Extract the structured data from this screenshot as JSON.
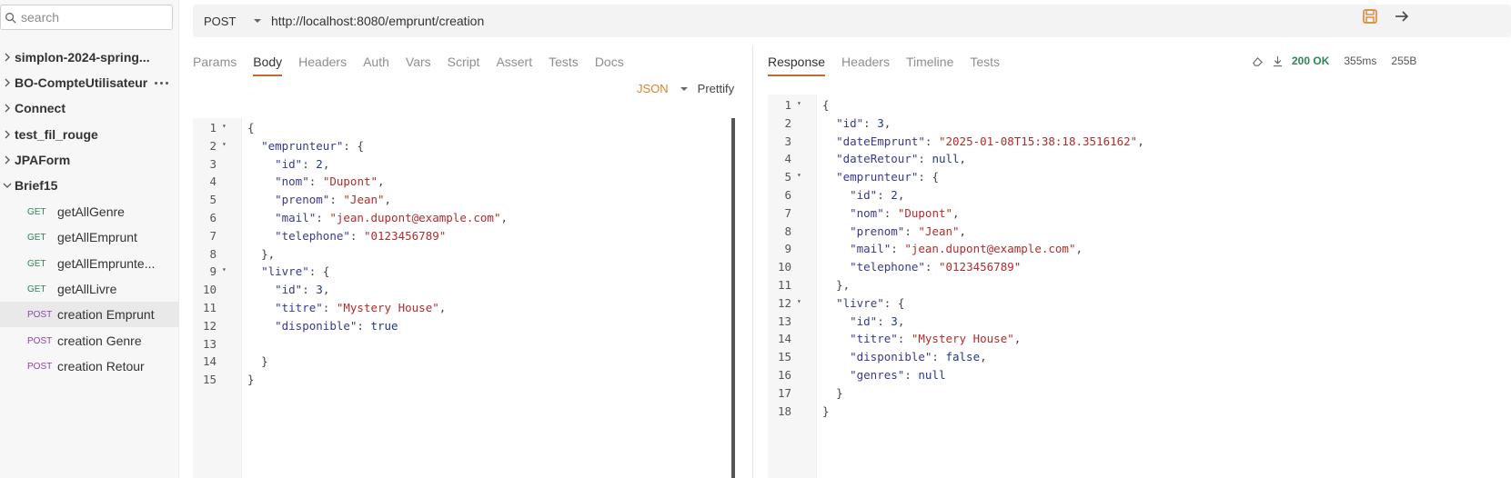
{
  "sidebar": {
    "search_placeholder": "search",
    "collections": [
      {
        "name": "simplon-2024-spring..."
      },
      {
        "name": "BO-CompteUtilisateur"
      },
      {
        "name": "Connect"
      },
      {
        "name": "test_fil_rouge"
      },
      {
        "name": "JPAForm"
      },
      {
        "name": "Brief15"
      }
    ],
    "requests": [
      {
        "method": "GET",
        "name": "getAllGenre"
      },
      {
        "method": "GET",
        "name": "getAllEmprunt"
      },
      {
        "method": "GET",
        "name": "getAllEmprunte..."
      },
      {
        "method": "GET",
        "name": "getAllLivre"
      },
      {
        "method": "POST",
        "name": "creation Emprunt"
      },
      {
        "method": "POST",
        "name": "creation Genre"
      },
      {
        "method": "POST",
        "name": "creation Retour"
      }
    ]
  },
  "urlbar": {
    "method": "POST",
    "url": "http://localhost:8080/emprunt/creation"
  },
  "request_tabs": [
    "Params",
    "Body",
    "Headers",
    "Auth",
    "Vars",
    "Script",
    "Assert",
    "Tests",
    "Docs"
  ],
  "body_mode": "JSON",
  "prettify_label": "Prettify",
  "response_tabs": [
    "Response",
    "Headers",
    "Timeline",
    "Tests"
  ],
  "status": {
    "code": "200 OK",
    "time": "355ms",
    "size": "255B"
  },
  "request_body_lines": [
    "{",
    "  \"emprunteur\": {",
    "    \"id\": 2,",
    "    \"nom\": \"Dupont\",",
    "    \"prenom\": \"Jean\",",
    "    \"mail\": \"jean.dupont@example.com\",",
    "    \"telephone\": \"0123456789\"",
    "  },",
    "  \"livre\": {",
    "    \"id\": 3,",
    "    \"titre\": \"Mystery House\",",
    "    \"disponible\": true",
    "",
    "  }",
    "}"
  ],
  "response_body_lines": [
    "{",
    "  \"id\": 3,",
    "  \"dateEmprunt\": \"2025-01-08T15:38:18.3516162\",",
    "  \"dateRetour\": null,",
    "  \"emprunteur\": {",
    "    \"id\": 2,",
    "    \"nom\": \"Dupont\",",
    "    \"prenom\": \"Jean\",",
    "    \"mail\": \"jean.dupont@example.com\",",
    "    \"telephone\": \"0123456789\"",
    "  },",
    "  \"livre\": {",
    "    \"id\": 3,",
    "    \"titre\": \"Mystery House\",",
    "    \"disponible\": false,",
    "    \"genres\": null",
    "  }",
    "}"
  ],
  "colors": {
    "accent": "#c16a2e",
    "get": "#2e8555",
    "post": "#8e44ad",
    "json_mode": "#d9822b"
  }
}
